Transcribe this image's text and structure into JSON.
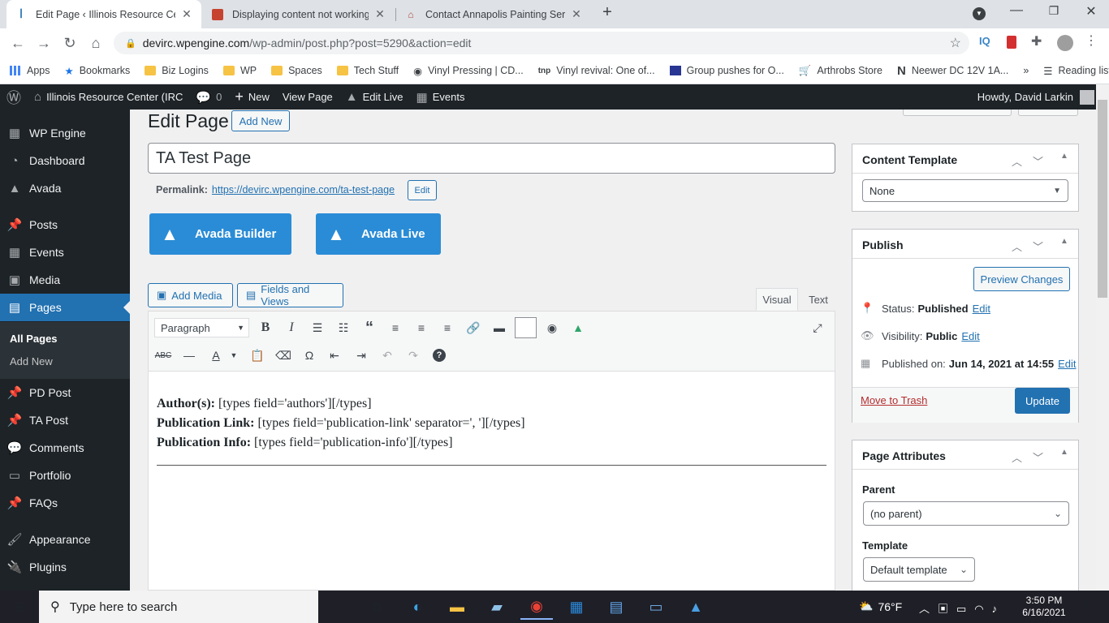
{
  "browser": {
    "tabs": [
      {
        "title": "Edit Page ‹ Illinois Resource Cent",
        "active": true
      },
      {
        "title": "Displaying content not working -",
        "active": false
      },
      {
        "title": "Contact Annapolis Painting Servic",
        "active": false
      }
    ],
    "url_host": "devirc.wpengine.com",
    "url_path": "/wp-admin/post.php?post=5290&action=edit",
    "bookmarks": [
      "Apps",
      "Bookmarks",
      "Biz Logins",
      "WP",
      "Spaces",
      "Tech Stuff",
      "Vinyl Pressing | CD...",
      "Vinyl revival: One of...",
      "Group pushes for O...",
      "Arthrobs Store",
      "Neewer DC 12V 1A..."
    ],
    "more_bookmarks": "»",
    "reading_list": "Reading list"
  },
  "adminbar": {
    "site": "Illinois Resource Center (IRC",
    "comments": "0",
    "new": "New",
    "view": "View Page",
    "edit_live": "Edit Live",
    "events": "Events",
    "howdy": "Howdy, David Larkin"
  },
  "sidebar": {
    "items": [
      {
        "label": "WP Engine",
        "icon": "wp-engine-icon"
      },
      {
        "label": "Dashboard",
        "icon": "dashboard-icon"
      },
      {
        "label": "Avada",
        "icon": "avada-icon"
      },
      {
        "label": "Posts",
        "icon": "pin-icon"
      },
      {
        "label": "Events",
        "icon": "calendar-icon"
      },
      {
        "label": "Media",
        "icon": "media-icon"
      },
      {
        "label": "Pages",
        "icon": "pages-icon"
      },
      {
        "label": "PD Post",
        "icon": "pin-icon"
      },
      {
        "label": "TA Post",
        "icon": "pin-icon"
      },
      {
        "label": "Comments",
        "icon": "comment-icon"
      },
      {
        "label": "Portfolio",
        "icon": "portfolio-icon"
      },
      {
        "label": "FAQs",
        "icon": "pin-icon"
      },
      {
        "label": "Appearance",
        "icon": "brush-icon"
      },
      {
        "label": "Plugins",
        "icon": "plug-icon"
      }
    ],
    "sub": [
      "All Pages",
      "Add New"
    ]
  },
  "main": {
    "heading": "Edit Page",
    "add_new": "Add New",
    "title_value": "TA Test Page",
    "permalink_label": "Permalink:",
    "permalink_url": "https://devirc.wpengine.com/ta-test-page",
    "permalink_edit": "Edit",
    "avada_builder": "Avada Builder",
    "avada_live": "Avada Live",
    "add_media": "Add Media",
    "fields_views": "Fields and Views",
    "tab_visual": "Visual",
    "tab_text": "Text",
    "format": "Paragraph",
    "content": [
      {
        "label": "Author(s):",
        "value": " [types field='authors'][/types]"
      },
      {
        "label": "Publication Link:",
        "value": " [types field='publication-link' separator=', '][/types]"
      },
      {
        "label": "Publication Info:",
        "value": " [types field='publication-info'][/types]"
      }
    ]
  },
  "right": {
    "content_template": {
      "title": "Content Template",
      "value": "None"
    },
    "publish": {
      "title": "Publish",
      "preview": "Preview Changes",
      "status_label": "Status:",
      "status": "Published",
      "visibility_label": "Visibility:",
      "visibility": "Public",
      "published_label": "Published on:",
      "published": "Jun 14, 2021 at 14:55",
      "edit": "Edit",
      "trash": "Move to Trash",
      "update": "Update"
    },
    "page_attributes": {
      "title": "Page Attributes",
      "parent_label": "Parent",
      "parent": "(no parent)",
      "template_label": "Template",
      "template": "Default template"
    }
  },
  "taskbar": {
    "search": "Type here to search",
    "weather": "76°F",
    "time": "3:50 PM",
    "date": "6/16/2021"
  }
}
